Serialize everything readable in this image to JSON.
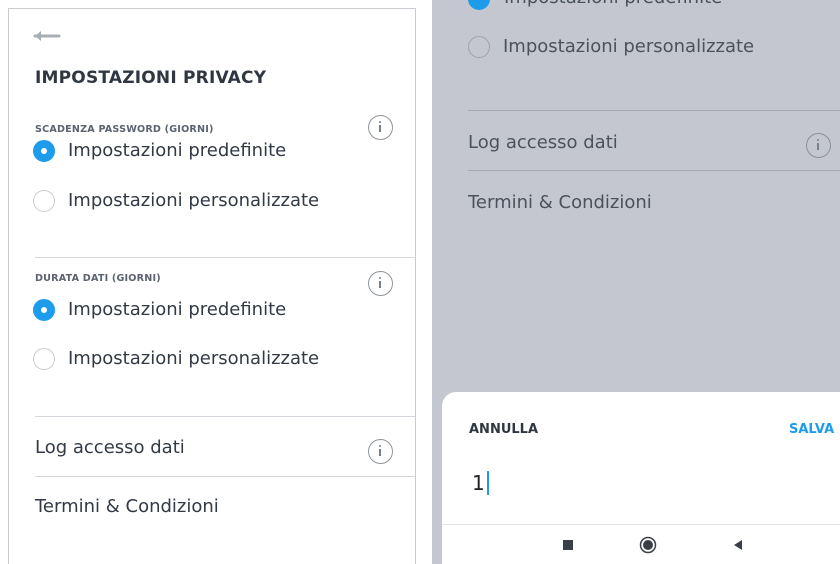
{
  "left": {
    "title": "IMPOSTAZIONI PRIVACY",
    "sections": [
      {
        "label": "SCADENZA PASSWORD (GIORNI)",
        "options": [
          {
            "label": "Impostazioni predefinite",
            "selected": true
          },
          {
            "label": "Impostazioni personalizzate",
            "selected": false
          }
        ]
      },
      {
        "label": "DURATA DATI (GIORNI)",
        "options": [
          {
            "label": "Impostazioni predefinite",
            "selected": true
          },
          {
            "label": "Impostazioni personalizzate",
            "selected": false
          }
        ]
      }
    ],
    "access_log_label": "Log accesso dati",
    "terms_label": "Termini & Condizioni"
  },
  "right": {
    "cut_off_option": "Impostazioni predefinite",
    "option_custom": "Impostazioni personalizzate",
    "access_log_label": "Log accesso dati",
    "terms_label": "Termini & Condizioni",
    "sheet": {
      "cancel_label": "ANNULLA",
      "save_label": "SALVA",
      "value": "1"
    }
  },
  "colors": {
    "accent": "#1e9cec",
    "overlay": "#c4c7d0",
    "text": "#323a45"
  },
  "icons": {
    "back": "arrow-left-icon",
    "info": "info-icon",
    "nav_recent": "square-stop-icon",
    "nav_home": "circle-home-icon",
    "nav_back": "triangle-back-icon"
  }
}
